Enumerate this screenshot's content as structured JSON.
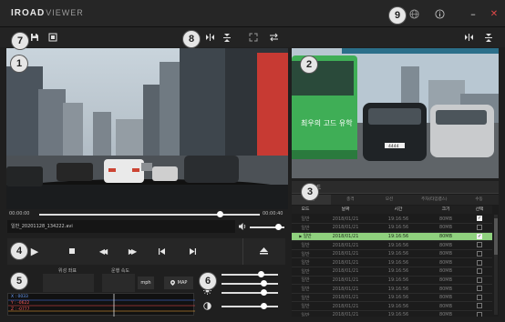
{
  "app": {
    "brand": "IROAD",
    "product": "VIEWER"
  },
  "window": {
    "globe_icon": "globe-icon",
    "info_icon": "info-icon",
    "minimize": "–",
    "close": "✕"
  },
  "markers": [
    "1",
    "2",
    "3",
    "4",
    "5",
    "6",
    "7",
    "8",
    "9"
  ],
  "playback": {
    "time_start": "00:00:00",
    "time_end": "00:00:40",
    "progress": 0.82,
    "volume": 0.82,
    "filename": "일반_20201128_134222.avi"
  },
  "gps": {
    "coord_label": "위성 좌표",
    "speed_label": "운행 속도",
    "unit_btn": "mph",
    "map_btn": "MAP"
  },
  "gsensor": {
    "x": "X : 0033",
    "y": "Y : -0622",
    "z": "Z : -0777"
  },
  "list": {
    "header_title": "모드",
    "tabs": [
      "일반",
      "충격",
      "모션",
      "주차(타임랩스)",
      "수동"
    ],
    "columns": [
      "모드",
      "날짜",
      "시간",
      "크기",
      "선택"
    ],
    "rows": [
      {
        "mode": "일반",
        "date": "2018/01/21",
        "time": "19:16:56",
        "size": "80MB",
        "checked": true,
        "selected": false
      },
      {
        "mode": "일반",
        "date": "2018/01/21",
        "time": "19:16:56",
        "size": "80MB",
        "checked": false,
        "selected": false
      },
      {
        "mode": "일반",
        "date": "2018/01/21",
        "time": "19:16:56",
        "size": "80MB",
        "checked": true,
        "selected": true
      },
      {
        "mode": "일반",
        "date": "2018/01/21",
        "time": "19:16:56",
        "size": "80MB",
        "checked": false,
        "selected": false
      },
      {
        "mode": "일반",
        "date": "2018/01/21",
        "time": "19:16:56",
        "size": "80MB",
        "checked": false,
        "selected": false
      },
      {
        "mode": "일반",
        "date": "2018/01/21",
        "time": "19:16:56",
        "size": "80MB",
        "checked": false,
        "selected": false
      },
      {
        "mode": "일반",
        "date": "2018/01/21",
        "time": "19:16:56",
        "size": "80MB",
        "checked": false,
        "selected": false
      },
      {
        "mode": "일반",
        "date": "2018/01/21",
        "time": "19:16:56",
        "size": "80MB",
        "checked": false,
        "selected": false
      },
      {
        "mode": "일반",
        "date": "2018/01/21",
        "time": "19:16:56",
        "size": "80MB",
        "checked": false,
        "selected": false
      },
      {
        "mode": "일반",
        "date": "2018/01/21",
        "time": "19:16:56",
        "size": "80MB",
        "checked": false,
        "selected": false
      },
      {
        "mode": "일반",
        "date": "2018/01/21",
        "time": "19:16:56",
        "size": "80MB",
        "checked": false,
        "selected": false
      },
      {
        "mode": "일반",
        "date": "2018/01/21",
        "time": "19:16:56",
        "size": "80MB",
        "checked": false,
        "selected": false
      }
    ]
  },
  "adjust": {
    "levels": [
      0.7,
      0.75,
      0.75,
      0.75
    ]
  },
  "rear_bus": {
    "sign": "최우의 고드 유학"
  },
  "rear_plate": "4444",
  "colors": {
    "selected_row": "#8fd17e",
    "gsensor_x": "#6aa0ff",
    "gsensor_y": "#ff5a5a",
    "gsensor_z": "#ff5a5a"
  }
}
